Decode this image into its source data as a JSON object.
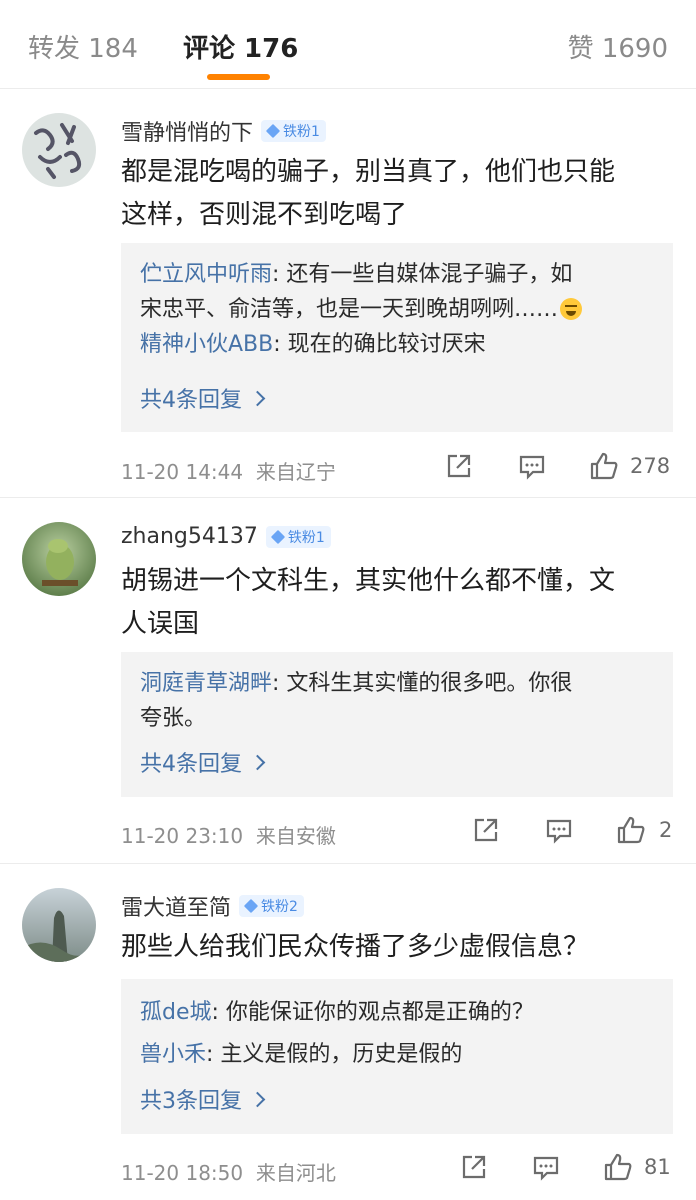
{
  "tabs": {
    "repost_label": "转发 184",
    "comment_label": "评论 176",
    "like_label": "赞 1690"
  },
  "accent_color": "#ff8200",
  "link_color": "#4672a7",
  "comments": [
    {
      "user": "雪静悄悄的下",
      "badge": "铁粉1",
      "text_line1": "都是混吃喝的骗子，别当真了，他们也只能",
      "text_line2": "这样，否则混不到吃喝了",
      "replies": [
        {
          "name": "伫立风中听雨",
          "text_line1": ": 还有一些自媒体混子骗子，如",
          "text_line2": "宋忠平、俞洁等，也是一天到晚胡咧咧……",
          "emoji": "laugh-cry-emoji"
        },
        {
          "name": "精神小伙ABB",
          "text_line1": ": 现在的确比较讨厌宋"
        }
      ],
      "more_label": "共4条回复",
      "time": "11-20 14:44",
      "location": "来自辽宁",
      "likes": "278"
    },
    {
      "user": "zhang54137",
      "badge": "铁粉1",
      "text_line1": "胡锡进一个文科生，其实他什么都不懂，文",
      "text_line2": "人误国",
      "replies": [
        {
          "name": "洞庭青草湖畔",
          "text_line1": ": 文科生其实懂的很多吧。你很",
          "text_line2": "夸张。"
        }
      ],
      "more_label": "共4条回复",
      "time": "11-20 23:10",
      "location": "来自安徽",
      "likes": "2"
    },
    {
      "user": "雷大道至简",
      "badge": "铁粉2",
      "text_line1": "那些人给我们民众传播了多少虚假信息？",
      "replies": [
        {
          "name": "孤de城",
          "text_line1": ": 你能保证你的观点都是正确的？"
        },
        {
          "name": "兽小禾",
          "text_line1": ": 主义是假的，历史是假的"
        }
      ],
      "more_label": "共3条回复",
      "time": "11-20 18:50",
      "location": "来自河北",
      "likes": "81"
    }
  ]
}
